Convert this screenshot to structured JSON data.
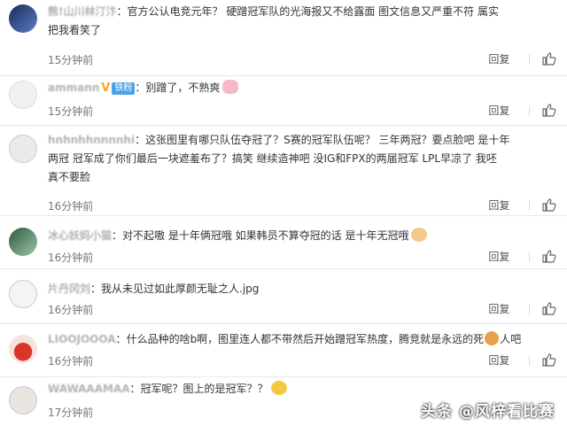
{
  "actions": {
    "reply": "回复"
  },
  "watermark": "头条 @风梓看比赛",
  "comments": [
    {
      "username": "熊!山川林汀汴",
      "text_line1": "官方公认电竞元年？ 硬蹭冠军队的光海报又不给露面 图文信息又严重不符 属实",
      "text_line2": "把我看笑了",
      "time": "15分钟前"
    },
    {
      "username": "ammann",
      "v_mark": "V",
      "badge": "铁粉",
      "text": "别蹭了，不熟爽",
      "time": "15分钟前"
    },
    {
      "username": "hnhnhhnnnnhi",
      "text_line1": "这张图里有哪只队伍夺冠了？S赛的冠军队伍呢？ 三年两冠？要点脸吧 是十年",
      "text_line2": "两冠 冠军成了你们最后一块遮羞布了？搞笑 继续造神吧 没IG和FPX的两届冠军 LPL早凉了 我呸",
      "text_line3": "真不要脸",
      "time": "16分钟前"
    },
    {
      "username": "冰心妖妈小猫",
      "text": "对不起嗷 是十年俩冠哦 如果韩员不算夺冠的话 是十年无冠哦",
      "time": "16分钟前"
    },
    {
      "username": "片丹冈刘",
      "text": "我从未见过如此厚颜无耻之人.jpg",
      "time": "16分钟前"
    },
    {
      "username": "LIOOJOOOA",
      "text": "什么品种的啥b啊，图里连人都不带然后开始蹭冠军热度，腾竞就是永远的死",
      "text_tail": "人吧",
      "time": "16分钟前"
    },
    {
      "username": "WAWAAAMAA",
      "text": "冠军呢？图上的是冠军？？",
      "time": "17分钟前"
    }
  ]
}
